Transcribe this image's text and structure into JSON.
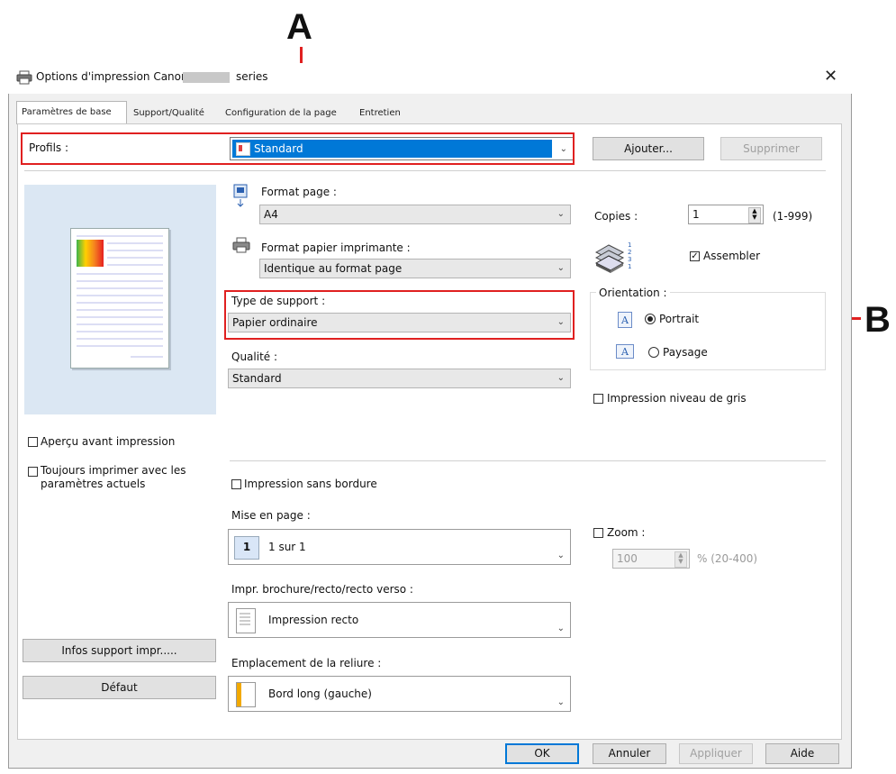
{
  "window": {
    "title": "Options d'impression Canon",
    "title_suffix": "series",
    "close_glyph": "✕"
  },
  "tabs": [
    {
      "label": "Paramètres de base",
      "active": true
    },
    {
      "label": "Support/Qualité"
    },
    {
      "label": "Configuration de la page"
    },
    {
      "label": "Entretien"
    }
  ],
  "profiles": {
    "label": "Profils :",
    "value": "Standard",
    "add_label": "Ajouter...",
    "delete_label": "Supprimer"
  },
  "page_size": {
    "label": "Format page :",
    "value": "A4"
  },
  "printer_paper_size": {
    "label": "Format papier imprimante :",
    "value": "Identique au format page"
  },
  "media_type": {
    "label": "Type de support :",
    "value": "Papier ordinaire"
  },
  "quality": {
    "label": "Qualité :",
    "value": "Standard"
  },
  "copies": {
    "label": "Copies :",
    "value": "1",
    "range": "(1-999)",
    "collate_label": "Assembler",
    "collate_checked": true
  },
  "orientation": {
    "label": "Orientation :",
    "portrait_label": "Portrait",
    "landscape_label": "Paysage",
    "selected": "Portrait"
  },
  "grayscale": {
    "label": "Impression niveau de gris",
    "checked": false
  },
  "preview_before": {
    "label": "Aperçu avant impression",
    "checked": false
  },
  "always_print": {
    "label_line1": "Toujours imprimer avec les",
    "label_line2": "paramètres actuels",
    "checked": false
  },
  "borderless": {
    "label": "Impression sans bordure",
    "checked": false
  },
  "page_layout": {
    "label": "Mise en page :",
    "icon_number": "1",
    "value": "1 sur 1"
  },
  "zoom": {
    "label": "Zoom :",
    "checked": false,
    "value": "100",
    "range": "% (20-400)"
  },
  "duplex": {
    "label": "Impr. brochure/recto/recto verso :",
    "value": "Impression recto"
  },
  "binding": {
    "label": "Emplacement de la reliure :",
    "value": "Bord long (gauche)"
  },
  "buttons": {
    "media_info": "Infos support impr.....",
    "defaults": "Défaut",
    "ok": "OK",
    "cancel": "Annuler",
    "apply": "Appliquer",
    "help": "Aide"
  },
  "callouts": {
    "a": "A",
    "b": "B"
  },
  "colors": {
    "annotation_red": "#e02020",
    "selection_blue": "#0078d7",
    "preview_bg": "#dbe7f3"
  }
}
